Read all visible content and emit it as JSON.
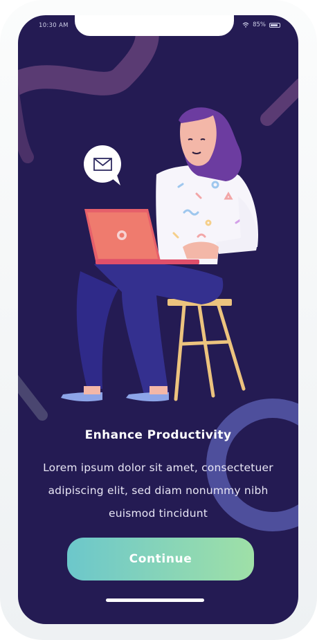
{
  "status_bar": {
    "time": "10:30 AM",
    "battery": "85%",
    "wifi_icon": "wifi-icon",
    "battery_icon": "battery-icon"
  },
  "onboarding": {
    "title": "Enhance Productivity",
    "description": "Lorem ipsum dolor sit amet, consectetuer adipiscing elit, sed diam nonummy nibh euismod tincidunt",
    "continue_label": "Continue"
  },
  "colors": {
    "screen_background": "#241b53",
    "cta_gradient_start": "#6cc7cb",
    "cta_gradient_end": "#9fe0a7",
    "accent_purple": "#4e4f9c",
    "laptop": "#e6606a"
  }
}
